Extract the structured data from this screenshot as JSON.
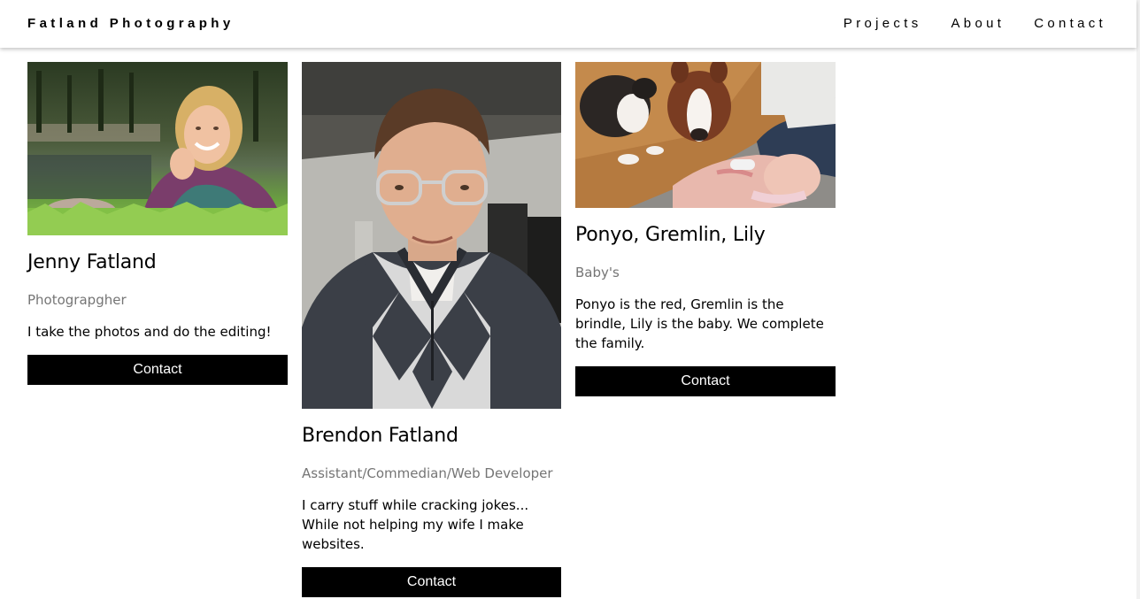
{
  "header": {
    "brand": "Fatland Photography",
    "nav": [
      "Projects",
      "About",
      "Contact"
    ]
  },
  "team": [
    {
      "name": "Jenny Fatland",
      "role": "Photograpgher",
      "bio": "I take the photos and do the editing!",
      "button": "Contact",
      "photo": "photo of smiling woman with curly blonde hair lying in grass by a pond"
    },
    {
      "name": "Brendon Fatland",
      "role": "Assistant/Commedian/Web Developer",
      "bio": "I carry stuff while cracking jokes... While not helping my wife I make websites.",
      "button": "Contact",
      "photo": "selfie of man with glasses wearing argyle sweater"
    },
    {
      "name": "Ponyo, Gremlin, Lily",
      "role": "Baby's",
      "bio": "Ponyo is the red, Gremlin is the brindle, Lily is the baby. We complete the family.",
      "button": "Contact",
      "photo": "two boston terriers on a wood floor next to a sleeping newborn baby"
    }
  ],
  "colors": {
    "button_bg": "#000000",
    "button_text": "#ffffff",
    "role_text": "#757575"
  }
}
